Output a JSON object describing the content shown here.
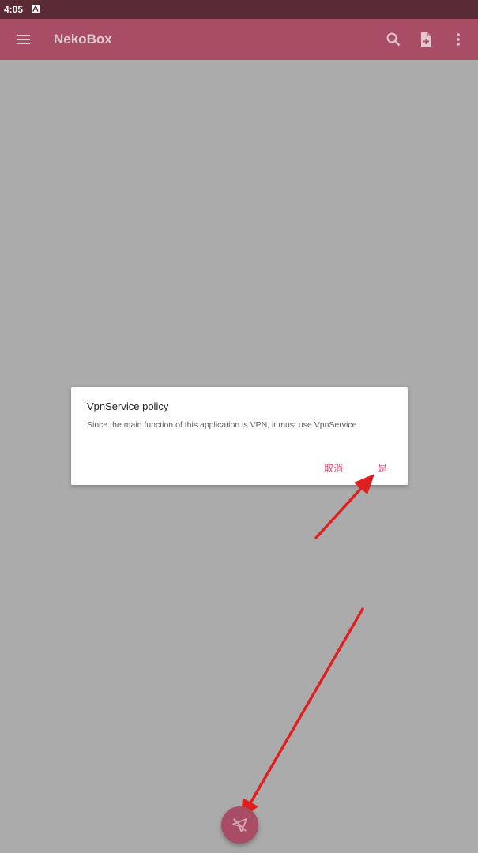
{
  "status_bar": {
    "time": "4:05"
  },
  "toolbar": {
    "title": "NekoBox",
    "icons": [
      "menu-icon",
      "search-icon",
      "add-file-icon",
      "more-vert-icon"
    ]
  },
  "dialog": {
    "title": "VpnService policy",
    "message": "Since the main function of this application is VPN, it must use VpnService.",
    "cancel_label": "取消",
    "confirm_label": "是"
  },
  "fab": {
    "icon": "vpn-off-icon"
  },
  "colors": {
    "toolbar": "#a84d64",
    "status_bar": "#5a2a35",
    "dialog_accent": "#e04a74",
    "scrim_background": "#ababab",
    "annotation_arrow": "#e02020"
  }
}
